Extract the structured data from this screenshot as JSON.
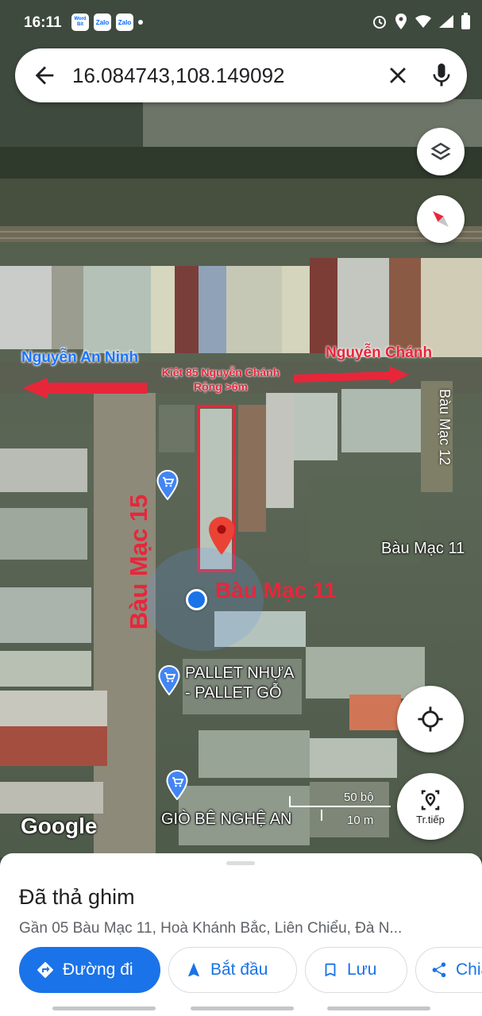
{
  "status_bar": {
    "time": "16:11",
    "notifications": [
      "Word Bit",
      "Zalo",
      "Zalo"
    ]
  },
  "search": {
    "value": "16.084743,108.149092",
    "back_icon": "arrow-back-icon",
    "clear_icon": "close-icon",
    "mic_icon": "mic-icon"
  },
  "map": {
    "labels": {
      "left_street": "Nguyễn An Ninh",
      "right_street": "Nguyễn Chánh",
      "kiet_line1": "Kiệt 85 Nguyễn Chánh",
      "kiet_line2": "Rộng >6m",
      "bau_mac_15": "Bàu Mạc 15",
      "bau_mac_11_red": "Bàu Mạc 11",
      "bau_mac_11": "Bàu Mạc 11",
      "bau_mac_12": "Bàu Mạc 12"
    },
    "pois": {
      "pallet_line1": "PALLET NHỰA",
      "pallet_line2": "- PALLET GỖ",
      "gio": "GIÒ BÊ NGHỆ AN"
    },
    "attribution": "Google",
    "scale": {
      "imperial": "50 bộ",
      "metric": "10 m"
    },
    "buttons": {
      "navigate_label": "Tr.tiếp"
    },
    "colors": {
      "annotation_red": "#e8263a",
      "annotation_blue": "#1a73ff",
      "pin_red": "#ea4335",
      "location_blue": "#1a73e8"
    }
  },
  "sheet": {
    "title": "Đã thả ghim",
    "address": "Gần 05 Bàu Mạc 11, Hoà Khánh Bắc, Liên Chiểu, Đà N...",
    "actions": {
      "directions": "Đường đi",
      "start": "Bắt đầu",
      "save": "Lưu",
      "share": "Chia"
    }
  }
}
